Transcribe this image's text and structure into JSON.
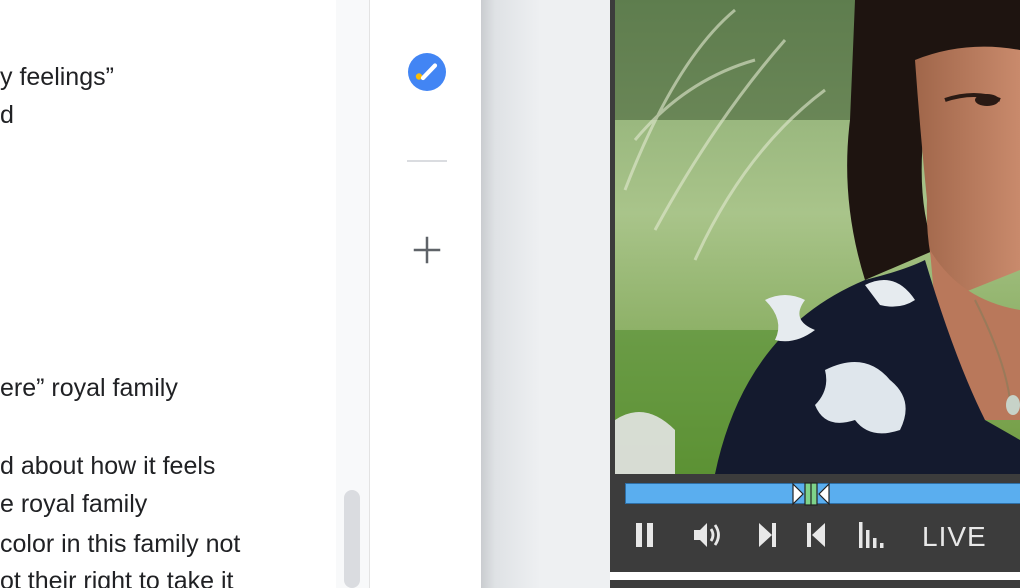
{
  "document": {
    "lines": [
      "y feelings”",
      "d",
      "ere” royal family",
      "d about how it feels",
      "e royal family",
      "color in this family not",
      "ot their right to take it"
    ]
  },
  "player": {
    "live_label": "LIVE",
    "progress_fraction": 0.47
  },
  "colors": {
    "tasks_blue": "#4285f4",
    "tasks_yellow": "#fbbc04",
    "progress_blue": "#5aaeef",
    "player_bg": "#3c3c3c"
  },
  "icons": {
    "side_panel": [
      "tasks-icon",
      "add-icon"
    ],
    "controls": [
      "pause-icon",
      "volume-icon",
      "next-icon",
      "previous-icon",
      "stats-icon"
    ]
  }
}
